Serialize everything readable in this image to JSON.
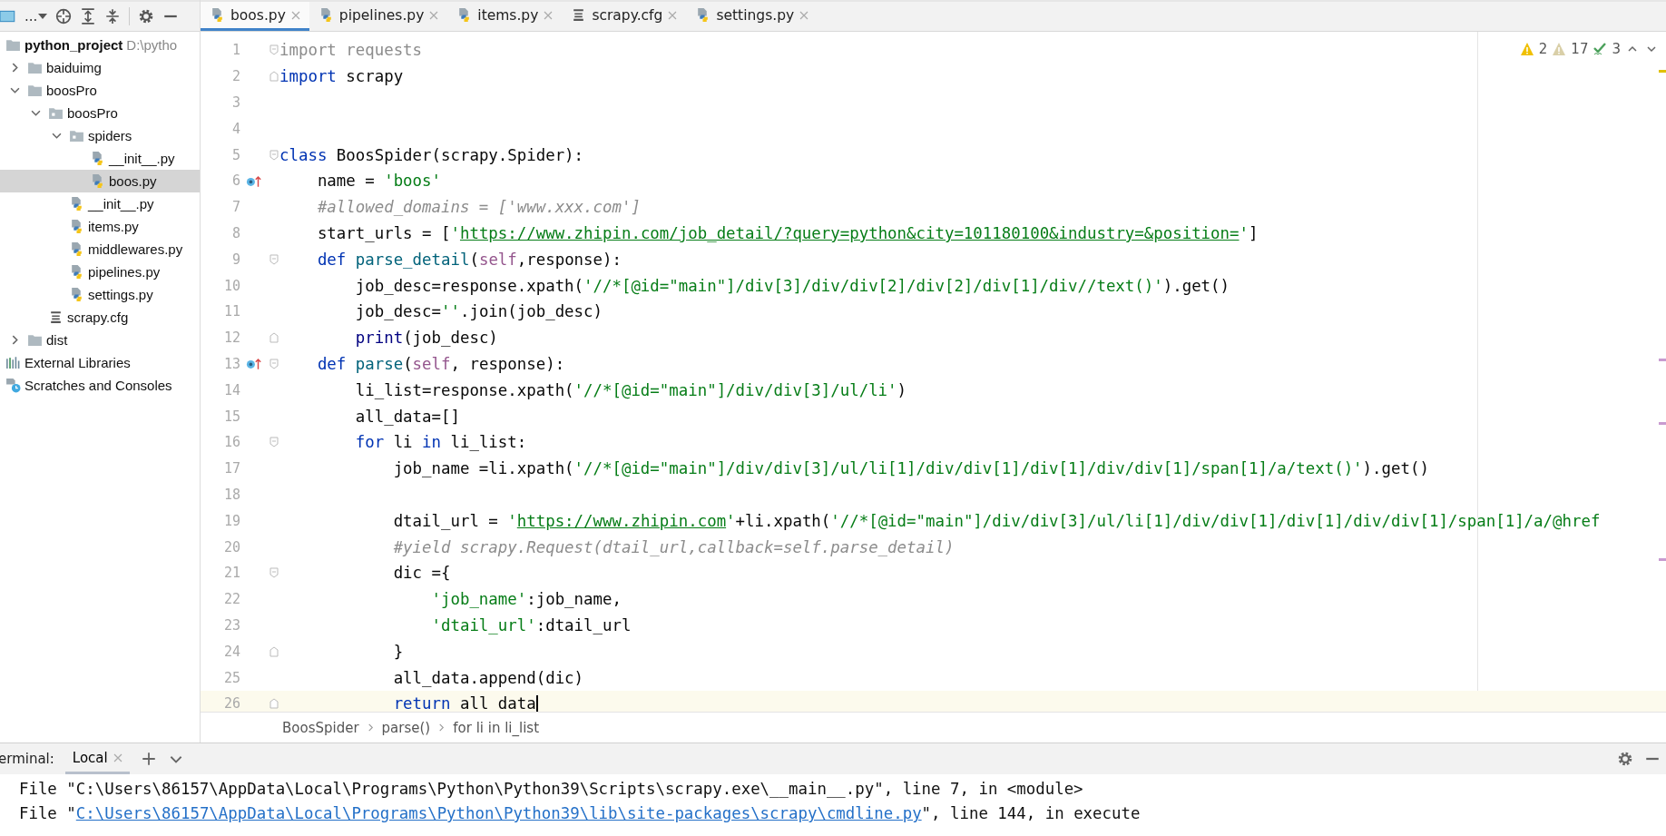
{
  "toolbar": {
    "view_label": "..."
  },
  "tabs": [
    {
      "label": "boos.py",
      "kind": "python",
      "selected": true
    },
    {
      "label": "pipelines.py",
      "kind": "python",
      "selected": false
    },
    {
      "label": "items.py",
      "kind": "python",
      "selected": false
    },
    {
      "label": "scrapy.cfg",
      "kind": "cfg",
      "selected": false
    },
    {
      "label": "settings.py",
      "kind": "python",
      "selected": false
    }
  ],
  "tree": [
    {
      "label": "python_project",
      "path": "D:\\pytho",
      "kind": "project",
      "selected": false
    },
    {
      "label": "baiduimg",
      "kind": "folder",
      "expanded": false,
      "selected": false
    },
    {
      "label": "boosPro",
      "kind": "folder",
      "expanded": true,
      "selected": false,
      "children": [
        {
          "label": "boosPro",
          "kind": "package",
          "expanded": true,
          "selected": false,
          "children": [
            {
              "label": "spiders",
              "kind": "package",
              "expanded": true,
              "selected": false,
              "children": [
                {
                  "label": "__init__.py",
                  "kind": "python",
                  "selected": false
                },
                {
                  "label": "boos.py",
                  "kind": "python",
                  "selected": true
                }
              ]
            },
            {
              "label": "__init__.py",
              "kind": "python",
              "selected": false
            },
            {
              "label": "items.py",
              "kind": "python",
              "selected": false
            },
            {
              "label": "middlewares.py",
              "kind": "python",
              "selected": false
            },
            {
              "label": "pipelines.py",
              "kind": "python",
              "selected": false
            },
            {
              "label": "settings.py",
              "kind": "python",
              "selected": false
            }
          ]
        },
        {
          "label": "scrapy.cfg",
          "kind": "cfg",
          "selected": false
        }
      ]
    },
    {
      "label": "dist",
      "kind": "folder",
      "expanded": false,
      "selected": false
    },
    {
      "label": "External Libraries",
      "kind": "libraries",
      "selected": false
    },
    {
      "label": "Scratches and Consoles",
      "kind": "scratches",
      "selected": false
    }
  ],
  "inspections": {
    "errors": "2",
    "warnings": "17",
    "typos": "3"
  },
  "lines": [
    {
      "n": "1",
      "fold_start": true,
      "fold_end": false,
      "override": false,
      "current": false,
      "tokens": [
        {
          "kind": "unused",
          "text": "import requests"
        }
      ]
    },
    {
      "n": "2",
      "fold_start": false,
      "fold_end": true,
      "override": false,
      "current": false,
      "tokens": [
        {
          "kind": "kw",
          "text": "import"
        },
        {
          "kind": "plain",
          "text": " scrapy"
        }
      ]
    },
    {
      "n": "3",
      "fold_start": false,
      "fold_end": false,
      "override": false,
      "current": false
    },
    {
      "n": "4",
      "fold_start": false,
      "fold_end": false,
      "override": false,
      "current": false
    },
    {
      "n": "5",
      "fold_start": true,
      "fold_end": false,
      "override": false,
      "current": false,
      "tokens": [
        {
          "kind": "kw",
          "text": "class"
        },
        {
          "kind": "plain",
          "text": " BoosSpider(scrapy.Spider):"
        }
      ]
    },
    {
      "n": "6",
      "fold_start": false,
      "fold_end": false,
      "override": true,
      "current": false,
      "tokens": [
        {
          "kind": "plain",
          "text": "    name = "
        },
        {
          "kind": "str",
          "text": "'boos'"
        }
      ]
    },
    {
      "n": "7",
      "fold_start": false,
      "fold_end": false,
      "override": false,
      "current": false,
      "tokens": [
        {
          "kind": "comment",
          "text": "    #allowed_domains = ['www.xxx.com']"
        }
      ]
    },
    {
      "n": "8",
      "fold_start": false,
      "fold_end": false,
      "override": false,
      "current": false,
      "tokens": [
        {
          "kind": "plain",
          "text": "    start_urls = ["
        },
        {
          "kind": "str",
          "text": "'"
        },
        {
          "kind": "url",
          "text": "https://www.zhipin.com/job_detail/?query=python&city=101180100&industry=&position="
        },
        {
          "kind": "str",
          "text": "'"
        },
        {
          "kind": "plain",
          "text": "]"
        }
      ]
    },
    {
      "n": "9",
      "fold_start": true,
      "fold_end": false,
      "override": false,
      "current": false,
      "tokens": [
        {
          "kind": "kw",
          "text": "    def"
        },
        {
          "kind": "fn",
          "text": " parse_detail"
        },
        {
          "kind": "plain",
          "text": "("
        },
        {
          "kind": "self",
          "text": "self"
        },
        {
          "kind": "plain",
          "text": ",response):"
        }
      ]
    },
    {
      "n": "10",
      "fold_start": false,
      "fold_end": false,
      "override": false,
      "current": false,
      "tokens": [
        {
          "kind": "plain",
          "text": "        job_desc=response.xpath("
        },
        {
          "kind": "str",
          "text": "'//*[@id=\"main\"]/div[3]/div/div[2]/div[2]/div[1]/div//text()'"
        },
        {
          "kind": "plain",
          "text": ").get()"
        }
      ]
    },
    {
      "n": "11",
      "fold_start": false,
      "fold_end": false,
      "override": false,
      "current": false,
      "tokens": [
        {
          "kind": "plain",
          "text": "        job_desc="
        },
        {
          "kind": "str",
          "text": "''"
        },
        {
          "kind": "plain",
          "text": ".join(job_desc)"
        }
      ]
    },
    {
      "n": "12",
      "fold_start": false,
      "fold_end": true,
      "override": false,
      "current": false,
      "tokens": [
        {
          "kind": "builtin",
          "text": "        print"
        },
        {
          "kind": "plain",
          "text": "(job_desc)"
        }
      ]
    },
    {
      "n": "13",
      "fold_start": true,
      "fold_end": false,
      "override": true,
      "current": false,
      "tokens": [
        {
          "kind": "kw",
          "text": "    def"
        },
        {
          "kind": "fn",
          "text": " parse"
        },
        {
          "kind": "plain",
          "text": "("
        },
        {
          "kind": "self",
          "text": "self"
        },
        {
          "kind": "plain",
          "text": ", response):"
        }
      ]
    },
    {
      "n": "14",
      "fold_start": false,
      "fold_end": false,
      "override": false,
      "current": false,
      "tokens": [
        {
          "kind": "plain",
          "text": "        li_list=response.xpath("
        },
        {
          "kind": "str",
          "text": "'//*[@id=\"main\"]/div/div[3]/ul/li'"
        },
        {
          "kind": "plain",
          "text": ")"
        }
      ]
    },
    {
      "n": "15",
      "fold_start": false,
      "fold_end": false,
      "override": false,
      "current": false,
      "tokens": [
        {
          "kind": "plain",
          "text": "        all_data=[]"
        }
      ]
    },
    {
      "n": "16",
      "fold_start": true,
      "fold_end": false,
      "override": false,
      "current": false,
      "tokens": [
        {
          "kind": "kw",
          "text": "        for"
        },
        {
          "kind": "plain",
          "text": " li "
        },
        {
          "kind": "kw",
          "text": "in"
        },
        {
          "kind": "plain",
          "text": " li_list:"
        }
      ]
    },
    {
      "n": "17",
      "fold_start": false,
      "fold_end": false,
      "override": false,
      "current": false,
      "tokens": [
        {
          "kind": "plain",
          "text": "            job_name =li.xpath("
        },
        {
          "kind": "str",
          "text": "'//*[@id=\"main\"]/div/div[3]/ul/li[1]/div/div[1]/div[1]/div/div[1]/span[1]/a/text()'"
        },
        {
          "kind": "plain",
          "text": ").get()"
        }
      ]
    },
    {
      "n": "18",
      "fold_start": false,
      "fold_end": false,
      "override": false,
      "current": false
    },
    {
      "n": "19",
      "fold_start": false,
      "fold_end": false,
      "override": false,
      "current": false,
      "tokens": [
        {
          "kind": "plain",
          "text": "            dtail_url = "
        },
        {
          "kind": "str",
          "text": "'"
        },
        {
          "kind": "url",
          "text": "https://www.zhipin.com"
        },
        {
          "kind": "str",
          "text": "'"
        },
        {
          "kind": "plain",
          "text": "+li.xpath("
        },
        {
          "kind": "str",
          "text": "'//*[@id=\"main\"]/div/div[3]/ul/li[1]/div/div[1]/div[1]/div/div[1]/span[1]/a/@href"
        }
      ]
    },
    {
      "n": "20",
      "fold_start": false,
      "fold_end": false,
      "override": false,
      "current": false,
      "tokens": [
        {
          "kind": "comment",
          "text": "            #yield scrapy.Request(dtail_url,callback=self.parse_detail)"
        }
      ]
    },
    {
      "n": "21",
      "fold_start": true,
      "fold_end": false,
      "override": false,
      "current": false,
      "tokens": [
        {
          "kind": "plain",
          "text": "            dic ={"
        }
      ]
    },
    {
      "n": "22",
      "fold_start": false,
      "fold_end": false,
      "override": false,
      "current": false,
      "tokens": [
        {
          "kind": "str",
          "text": "                'job_name'"
        },
        {
          "kind": "plain",
          "text": ":job_name,"
        }
      ]
    },
    {
      "n": "23",
      "fold_start": false,
      "fold_end": false,
      "override": false,
      "current": false,
      "tokens": [
        {
          "kind": "str",
          "text": "                'dtail_url'"
        },
        {
          "kind": "plain",
          "text": ":dtail_url"
        }
      ]
    },
    {
      "n": "24",
      "fold_start": false,
      "fold_end": true,
      "override": false,
      "current": false,
      "tokens": [
        {
          "kind": "plain",
          "text": "            }"
        }
      ]
    },
    {
      "n": "25",
      "fold_start": false,
      "fold_end": false,
      "override": false,
      "current": false,
      "tokens": [
        {
          "kind": "plain",
          "text": "            all_data.append(dic)"
        }
      ]
    },
    {
      "n": "26",
      "fold_start": false,
      "fold_end": true,
      "override": false,
      "current": true,
      "tokens": [
        {
          "kind": "kw",
          "text": "            return"
        },
        {
          "kind": "plain",
          "text": " all_data"
        }
      ]
    }
  ],
  "breadcrumbs": [
    "BoosSpider",
    "parse()",
    "for li in li_list"
  ],
  "terminal": {
    "title": "erminal:",
    "tabs": [
      {
        "label": "Local",
        "selected": true
      }
    ],
    "lines": [
      [
        {
          "kind": "plain",
          "text": "  File \"C:\\Users\\86157\\AppData\\Local\\Programs\\Python\\Python39\\Scripts\\scrapy.exe\\__main__.py\", line 7, in <module>"
        }
      ],
      [
        {
          "kind": "plain",
          "text": "  File \""
        },
        {
          "kind": "link",
          "text": "C:\\Users\\86157\\AppData\\Local\\Programs\\Python\\Python39\\lib\\site-packages\\scrapy\\cmdline.py"
        },
        {
          "kind": "plain",
          "text": "\", line 144, in execute"
        }
      ]
    ]
  }
}
